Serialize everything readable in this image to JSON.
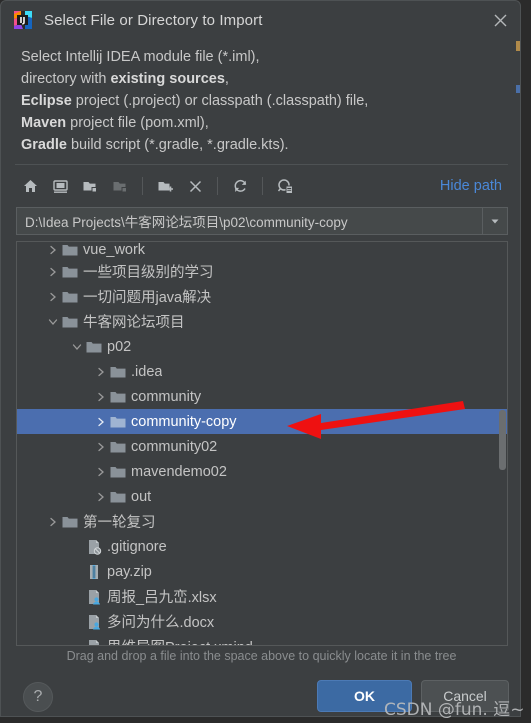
{
  "window": {
    "title": "Select File or Directory to Import",
    "app_icon": "intellij-idea-logo-icon",
    "close_icon": "close-icon"
  },
  "description": {
    "line1_pre": "Select Intellij IDEA module file (*.iml),",
    "line2_pre": "directory with ",
    "line2_bold": "existing sources",
    "line2_post": ",",
    "line3_bold": "Eclipse",
    "line3_post": " project (.project) or classpath (.classpath) file,",
    "line4_bold": "Maven",
    "line4_post": " project file (pom.xml),",
    "line5_bold": "Gradle",
    "line5_post": " build script (*.gradle, *.gradle.kts)."
  },
  "toolbar": {
    "buttons": [
      {
        "name": "home-icon",
        "tip": "Home"
      },
      {
        "name": "desktop-icon",
        "tip": "Desktop"
      },
      {
        "name": "project-folder-icon",
        "tip": "Project Directory"
      },
      {
        "name": "module-folder-icon",
        "tip": "Module Directory"
      },
      {
        "name": "new-folder-icon",
        "tip": "New Folder"
      },
      {
        "name": "delete-icon",
        "tip": "Delete"
      },
      {
        "name": "refresh-icon",
        "tip": "Refresh"
      },
      {
        "name": "show-hidden-files-icon",
        "tip": "Show Hidden Files and Directories"
      }
    ],
    "hide_path_label": "Hide path"
  },
  "path_field": {
    "value": "D:\\Idea Projects\\牛客网论坛项目\\p02\\community-copy",
    "placeholder": "",
    "dropdown_icon": "chevron-down-icon"
  },
  "tree": {
    "rows": [
      {
        "label": "vue_work",
        "indent": 1,
        "twisty": "collapsed",
        "icon": "folder-icon",
        "selected": false,
        "clipped": true
      },
      {
        "label": "一些项目级别的学习",
        "indent": 1,
        "twisty": "collapsed",
        "icon": "folder-icon",
        "selected": false
      },
      {
        "label": "一切问题用java解决",
        "indent": 1,
        "twisty": "collapsed",
        "icon": "folder-icon",
        "selected": false
      },
      {
        "label": "牛客网论坛项目",
        "indent": 1,
        "twisty": "expanded",
        "icon": "folder-icon",
        "selected": false
      },
      {
        "label": "p02",
        "indent": 2,
        "twisty": "expanded",
        "icon": "folder-icon",
        "selected": false
      },
      {
        "label": ".idea",
        "indent": 3,
        "twisty": "collapsed",
        "icon": "folder-icon",
        "selected": false
      },
      {
        "label": "community",
        "indent": 3,
        "twisty": "collapsed",
        "icon": "folder-icon",
        "selected": false
      },
      {
        "label": "community-copy",
        "indent": 3,
        "twisty": "collapsed",
        "icon": "folder-icon",
        "selected": true
      },
      {
        "label": "community02",
        "indent": 3,
        "twisty": "collapsed",
        "icon": "folder-icon",
        "selected": false
      },
      {
        "label": "mavendemo02",
        "indent": 3,
        "twisty": "collapsed",
        "icon": "folder-icon",
        "selected": false
      },
      {
        "label": "out",
        "indent": 3,
        "twisty": "collapsed",
        "icon": "folder-icon",
        "selected": false
      },
      {
        "label": "第一轮复习",
        "indent": 1,
        "twisty": "collapsed",
        "icon": "folder-icon",
        "selected": false
      },
      {
        "label": ".gitignore",
        "indent": 2,
        "twisty": "none",
        "icon": "gitignore-file-icon",
        "selected": false
      },
      {
        "label": "pay.zip",
        "indent": 2,
        "twisty": "none",
        "icon": "zip-file-icon",
        "selected": false
      },
      {
        "label": "周报_吕九峦.xlsx",
        "indent": 2,
        "twisty": "none",
        "icon": "user-file-icon",
        "selected": false
      },
      {
        "label": "多问为什么.docx",
        "indent": 2,
        "twisty": "none",
        "icon": "user-file-icon",
        "selected": false
      },
      {
        "label": "思维导图Project.xmind",
        "indent": 2,
        "twisty": "none",
        "icon": "user-file-icon",
        "selected": false,
        "clipped": true
      }
    ],
    "scrollbar": "vertical-scrollbar"
  },
  "annotation": {
    "arrow": "red-left-arrow",
    "arrow_color": "#ee1111"
  },
  "hint": "Drag and drop a file into the space above to quickly locate it in the tree",
  "footer": {
    "help_label": "?",
    "ok_label": "OK",
    "cancel_label": "Cancel"
  },
  "watermark": "CSDN @fun. 逗~",
  "colors": {
    "dialog_bg": "#3c3f41",
    "selection": "#4b6eaf",
    "link": "#4a88d8",
    "ok_button": "#3c6aa3",
    "folder": "#8a9299"
  }
}
